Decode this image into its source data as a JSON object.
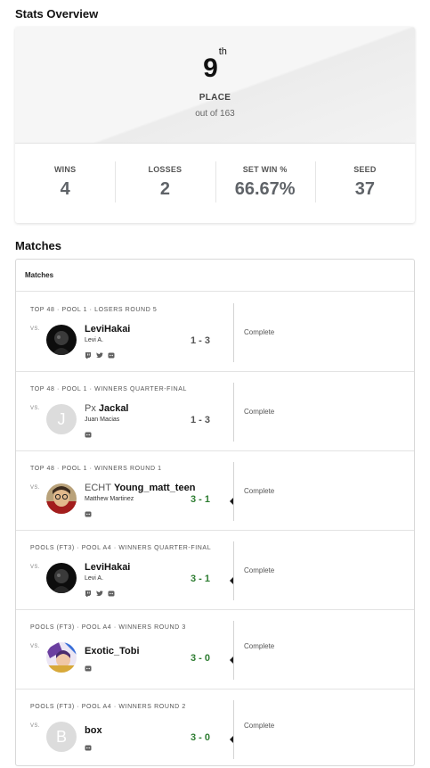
{
  "stats": {
    "title": "Stats Overview",
    "place": "9",
    "place_suffix": "th",
    "place_label": "PLACE",
    "place_sub": "out of 163",
    "items": [
      {
        "label": "WINS",
        "value": "4"
      },
      {
        "label": "LOSSES",
        "value": "2"
      },
      {
        "label": "SET WIN %",
        "value": "66.67%"
      },
      {
        "label": "SEED",
        "value": "37"
      }
    ]
  },
  "matches": {
    "title": "Matches",
    "header": "Matches",
    "vs_label": "VS.",
    "rows": [
      {
        "round": "TOP 48 · POOL 1 · LOSERS ROUND 5",
        "prefix": "",
        "name": "LeviHakai",
        "real_name": "Levi A.",
        "score": "1 - 3",
        "result": "loss",
        "status": "Complete",
        "socials": [
          "twitch-icon",
          "twitter-icon",
          "discord-icon"
        ]
      },
      {
        "round": "TOP 48 · POOL 1 · WINNERS QUARTER-FINAL",
        "prefix": "Px",
        "name": "Jackal",
        "real_name": "Juan Macias",
        "score": "1 - 3",
        "result": "loss",
        "status": "Complete",
        "avatar_letter": "J",
        "socials": [
          "discord-icon"
        ]
      },
      {
        "round": "TOP 48 · POOL 1 · WINNERS ROUND 1",
        "prefix": "ECHT",
        "name": "Young_matt_teen",
        "real_name": "Matthew Martinez",
        "score": "3 - 1",
        "result": "win",
        "status": "Complete",
        "socials": [
          "discord-icon"
        ]
      },
      {
        "round": "POOLS (FT3) · POOL A4 · WINNERS QUARTER-FINAL",
        "prefix": "",
        "name": "LeviHakai",
        "real_name": "Levi A.",
        "score": "3 - 1",
        "result": "win",
        "status": "Complete",
        "socials": [
          "twitch-icon",
          "twitter-icon",
          "discord-icon"
        ]
      },
      {
        "round": "POOLS (FT3) · POOL A4 · WINNERS ROUND 3",
        "prefix": "",
        "name": "Exotic_Tobi",
        "real_name": "",
        "score": "3 - 0",
        "result": "win",
        "status": "Complete",
        "socials": [
          "discord-icon"
        ]
      },
      {
        "round": "POOLS (FT3) · POOL A4 · WINNERS ROUND 2",
        "prefix": "",
        "name": "box",
        "real_name": "",
        "score": "3 - 0",
        "result": "win",
        "status": "Complete",
        "avatar_letter": "B",
        "socials": [
          "discord-icon"
        ]
      }
    ]
  },
  "colors": {
    "win": "#2e7d32",
    "loss": "#555555",
    "stat_value": "#5f6368",
    "avatar_placeholder": "#dcdcdc"
  }
}
